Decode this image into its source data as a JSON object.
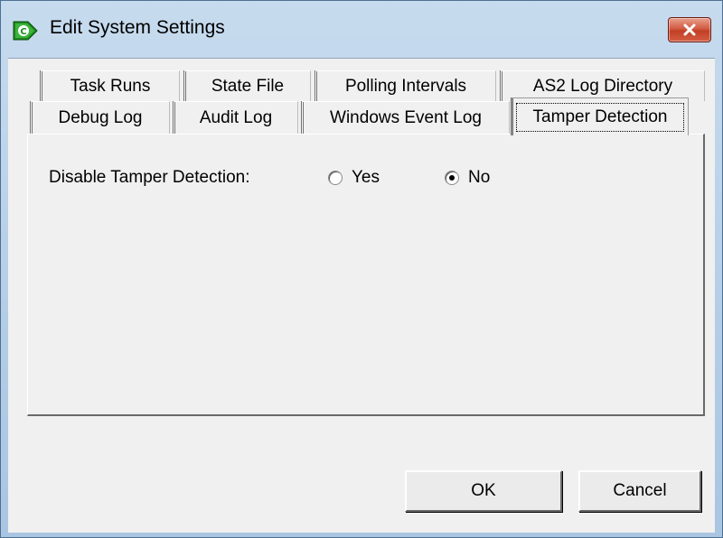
{
  "window": {
    "title": "Edit System Settings",
    "app_icon": "green-arrow-c-icon",
    "close_icon": "close-x-icon",
    "colors": {
      "titlebar": "#b9d1ea",
      "close": "#c9462c",
      "face": "#f0f0f0"
    }
  },
  "tabs": {
    "row1": [
      "Task Runs",
      "State File",
      "Polling Intervals",
      "AS2 Log Directory"
    ],
    "row2": [
      "Debug Log",
      "Audit Log",
      "Windows Event Log",
      "Tamper Detection"
    ],
    "active": "Tamper Detection"
  },
  "tamper": {
    "label": "Disable Tamper Detection:",
    "options": [
      {
        "label": "Yes",
        "selected": false
      },
      {
        "label": "No",
        "selected": true
      }
    ]
  },
  "buttons": {
    "ok": "OK",
    "cancel": "Cancel"
  }
}
